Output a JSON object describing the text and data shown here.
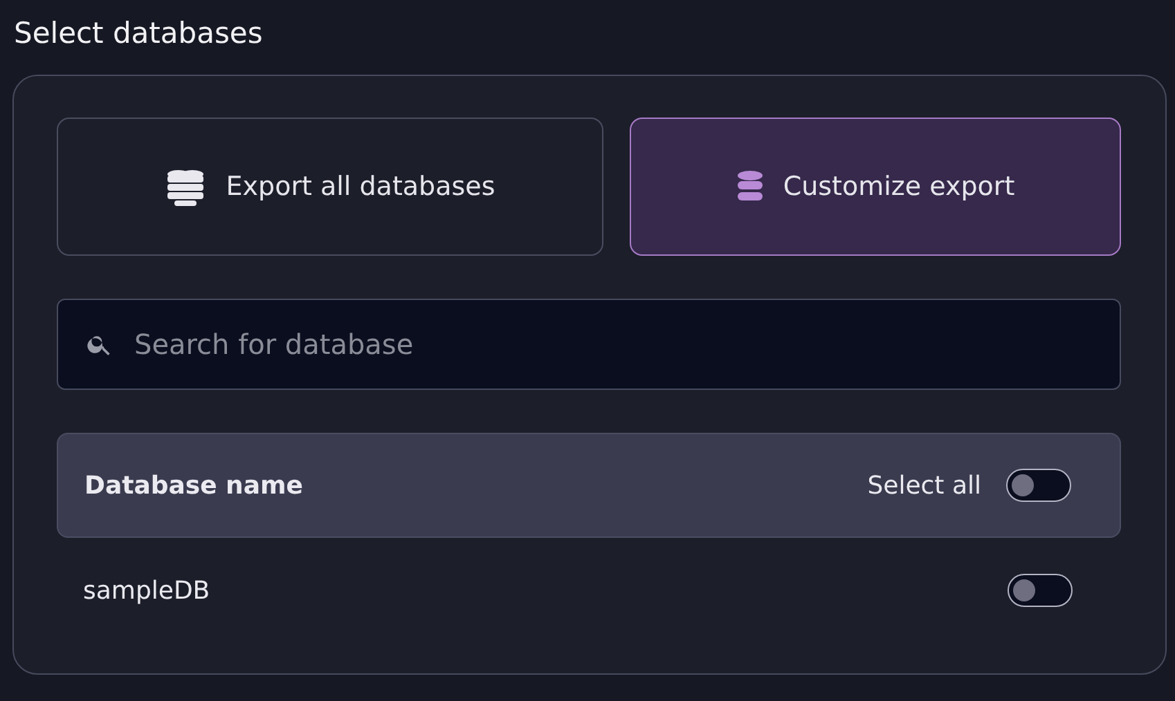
{
  "title": "Select databases",
  "export_options": [
    {
      "label": "Export all databases",
      "kind": "stack",
      "selected": false
    },
    {
      "label": "Customize export",
      "kind": "single",
      "selected": true
    }
  ],
  "search": {
    "placeholder": "Search for database"
  },
  "table": {
    "header": {
      "label": "Database name",
      "select_all_label": "Select all",
      "on": false
    },
    "rows": [
      {
        "name": "sampleDB",
        "on": false
      }
    ]
  }
}
